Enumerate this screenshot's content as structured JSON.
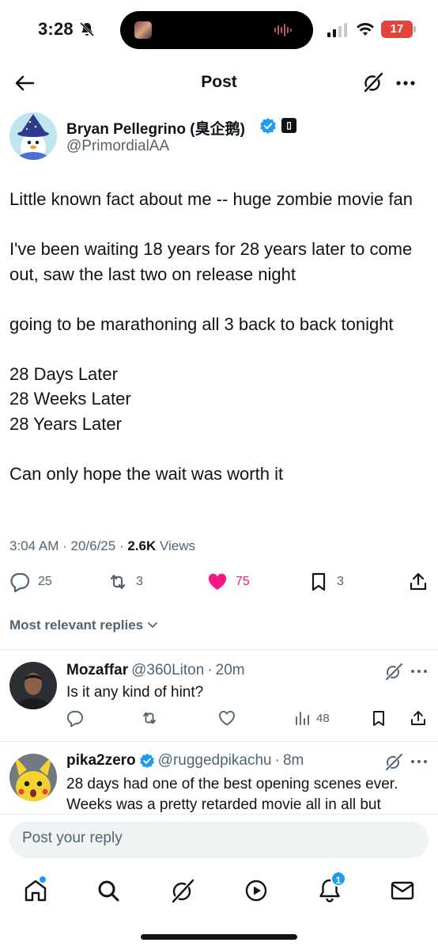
{
  "status_bar": {
    "time": "3:28",
    "battery": "17"
  },
  "header": {
    "title": "Post"
  },
  "post": {
    "author_name": "Bryan Pellegrino (臭企鹅)",
    "author_handle": "@PrimordialAA",
    "paragraphs": [
      "Little known fact about me -- huge zombie movie fan",
      "I've been waiting 18 years for 28 years later to come out, saw the last two on release night",
      "going to be marathoning all 3 back to back tonight"
    ],
    "list_lines": [
      "28 Days Later",
      "28 Weeks Later",
      "28 Years Later"
    ],
    "closing": "Can only hope the wait was worth it",
    "time": "3:04 AM",
    "date": "20/6/25",
    "views_count": "2.6K",
    "views_label": "Views",
    "replies": "25",
    "reposts": "3",
    "likes": "75",
    "bookmarks": "3"
  },
  "sort_label": "Most relevant replies",
  "replies": [
    {
      "name": "Mozaffar",
      "handle": "@360Liton",
      "time": "20m",
      "text": "Is it any kind of hint?",
      "views": "48"
    },
    {
      "name": "pika2zero",
      "handle": "@ruggedpikachu",
      "time": "8m",
      "text": "28 days had one of the best opening scenes ever. Weeks was a pretty retarded movie all in all but"
    }
  ],
  "composer": {
    "placeholder": "Post your reply"
  },
  "tabbar": {
    "notification_count": "1"
  },
  "colors": {
    "accent": "#1d9bf0",
    "like": "#f91880",
    "muted": "#536471",
    "text": "#0f1419"
  }
}
